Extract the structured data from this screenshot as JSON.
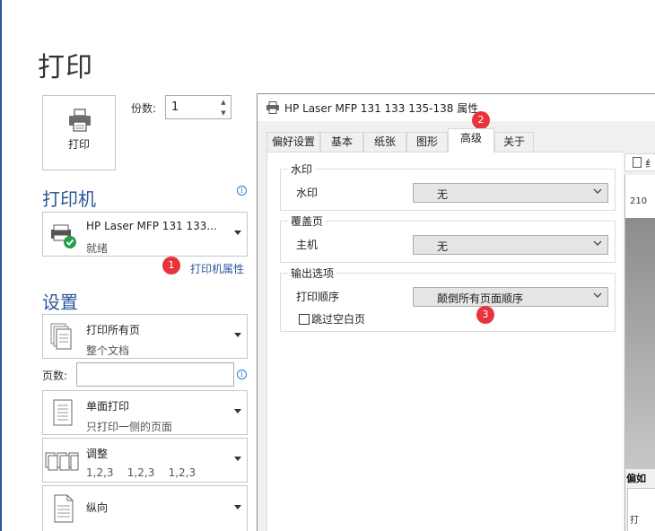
{
  "page": {
    "title": "打印"
  },
  "print_button": {
    "label": "打印"
  },
  "copies": {
    "label": "份数:",
    "value": "1"
  },
  "printer_section": {
    "heading": "打印机",
    "selected": {
      "name": "HP Laser MFP 131 133...",
      "status": "就绪"
    },
    "properties_link": "打印机属性"
  },
  "settings_section": {
    "heading": "设置",
    "print_range": {
      "title": "打印所有页",
      "sub": "整个文档"
    },
    "pages_label": "页数:",
    "pages_value": "",
    "sides": {
      "title": "单面打印",
      "sub": "只打印一侧的页面"
    },
    "collate": {
      "title": "调整",
      "sub": "1,2,3    1,2,3    1,2,3"
    },
    "orientation": {
      "title": "纵向"
    }
  },
  "badges": [
    "1",
    "2",
    "3"
  ],
  "dialog": {
    "title": "HP Laser MFP 131 133 135-138 属性",
    "tabs": [
      "偏好设置",
      "基本",
      "纸张",
      "图形",
      "高级",
      "关于"
    ],
    "active_tab": "高级",
    "groups": {
      "watermark": {
        "title": "水印",
        "label": "水印",
        "value": "无"
      },
      "overlay": {
        "title": "覆盖页",
        "label": "主机",
        "value": "无"
      },
      "output": {
        "title": "输出选项",
        "order_label": "打印顺序",
        "order_value": "颠倒所有页面顺序",
        "skip_blank_label": "跳过空白页"
      }
    },
    "preview": {
      "tab_text": "纟",
      "number": "210",
      "bottom_title": "偏如",
      "inner_text": "打",
      "inner_text2": "一"
    }
  },
  "colors": {
    "accent": "#2b579a",
    "badge": "#e8323c",
    "link": "#2b579a"
  }
}
